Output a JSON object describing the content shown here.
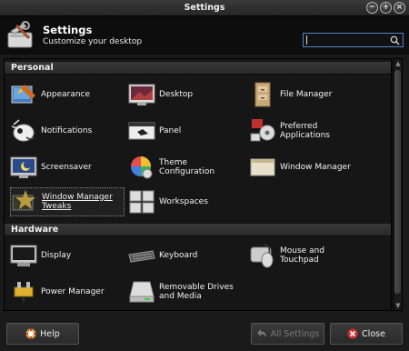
{
  "window": {
    "title": "Settings"
  },
  "header": {
    "title": "Settings",
    "subtitle": "Customize your desktop",
    "search_placeholder": ""
  },
  "categories": [
    {
      "name": "Personal",
      "items": [
        {
          "label": "Appearance",
          "icon": "appearance-icon"
        },
        {
          "label": "Desktop",
          "icon": "desktop-icon"
        },
        {
          "label": "File Manager",
          "icon": "file-manager-icon"
        },
        {
          "label": "Notifications",
          "icon": "notifications-icon"
        },
        {
          "label": "Panel",
          "icon": "panel-icon"
        },
        {
          "label": "Preferred\nApplications",
          "icon": "preferred-applications-icon"
        },
        {
          "label": "Screensaver",
          "icon": "screensaver-icon"
        },
        {
          "label": "Theme\nConfiguration",
          "icon": "theme-configuration-icon"
        },
        {
          "label": "Window Manager",
          "icon": "window-manager-icon"
        },
        {
          "label": "Window Manager\nTweaks",
          "icon": "window-manager-tweaks-icon"
        },
        {
          "label": "Workspaces",
          "icon": "workspaces-icon"
        }
      ]
    },
    {
      "name": "Hardware",
      "items": [
        {
          "label": "Display",
          "icon": "display-icon"
        },
        {
          "label": "Keyboard",
          "icon": "keyboard-icon"
        },
        {
          "label": "Mouse and\nTouchpad",
          "icon": "mouse-icon"
        },
        {
          "label": "Power Manager",
          "icon": "power-manager-icon"
        },
        {
          "label": "Removable Drives\nand Media",
          "icon": "removable-drives-icon"
        }
      ]
    }
  ],
  "buttons": {
    "help": "Help",
    "all_settings": "All Settings",
    "close": "Close"
  }
}
